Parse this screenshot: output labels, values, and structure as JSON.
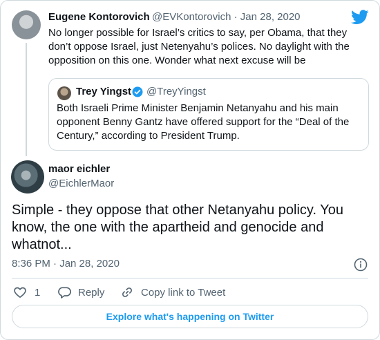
{
  "original_tweet": {
    "name": "Eugene Kontorovich",
    "handle_date": "@EVKontorovich · Jan 28, 2020",
    "text_lines": [
      "No longer possible for Israel’s critics to say, per Obama, that they",
      "don’t oppose Israel, just Netenyahu’s polices. No daylight with the",
      "opposition on this one. Wonder what next excuse will be"
    ]
  },
  "quoted_tweet": {
    "name": "Trey Yingst",
    "handle": "@TreyYingst",
    "text_lines": [
      "Both Israeli Prime Minister Benjamin Netanyahu and his main",
      "opponent Benny Gantz have offered support for the “Deal of the",
      "Century,” according to President Trump."
    ]
  },
  "reply_tweet": {
    "name": "maor eichler",
    "handle": "@EichlerMaor",
    "text_lines": [
      "Simple - they oppose that other Netanyahu policy. You",
      "know, the one with the apartheid and genocide and",
      "whatnot..."
    ],
    "timestamp": "8:36 PM · Jan 28, 2020"
  },
  "actions": {
    "like_count": "1",
    "reply_label": "Reply",
    "copy_link_label": "Copy link to Tweet"
  },
  "explore_label": "Explore what's happening on Twitter",
  "colors": {
    "accent": "#1d9bf0",
    "text": "#0f1419",
    "secondary": "#536471",
    "border": "#cfd9de"
  },
  "icons": {
    "brand": "twitter-bird-icon",
    "verified": "verified-badge-icon",
    "info": "info-icon",
    "like": "heart-icon",
    "reply": "reply-bubble-icon",
    "copy_link": "link-icon"
  }
}
